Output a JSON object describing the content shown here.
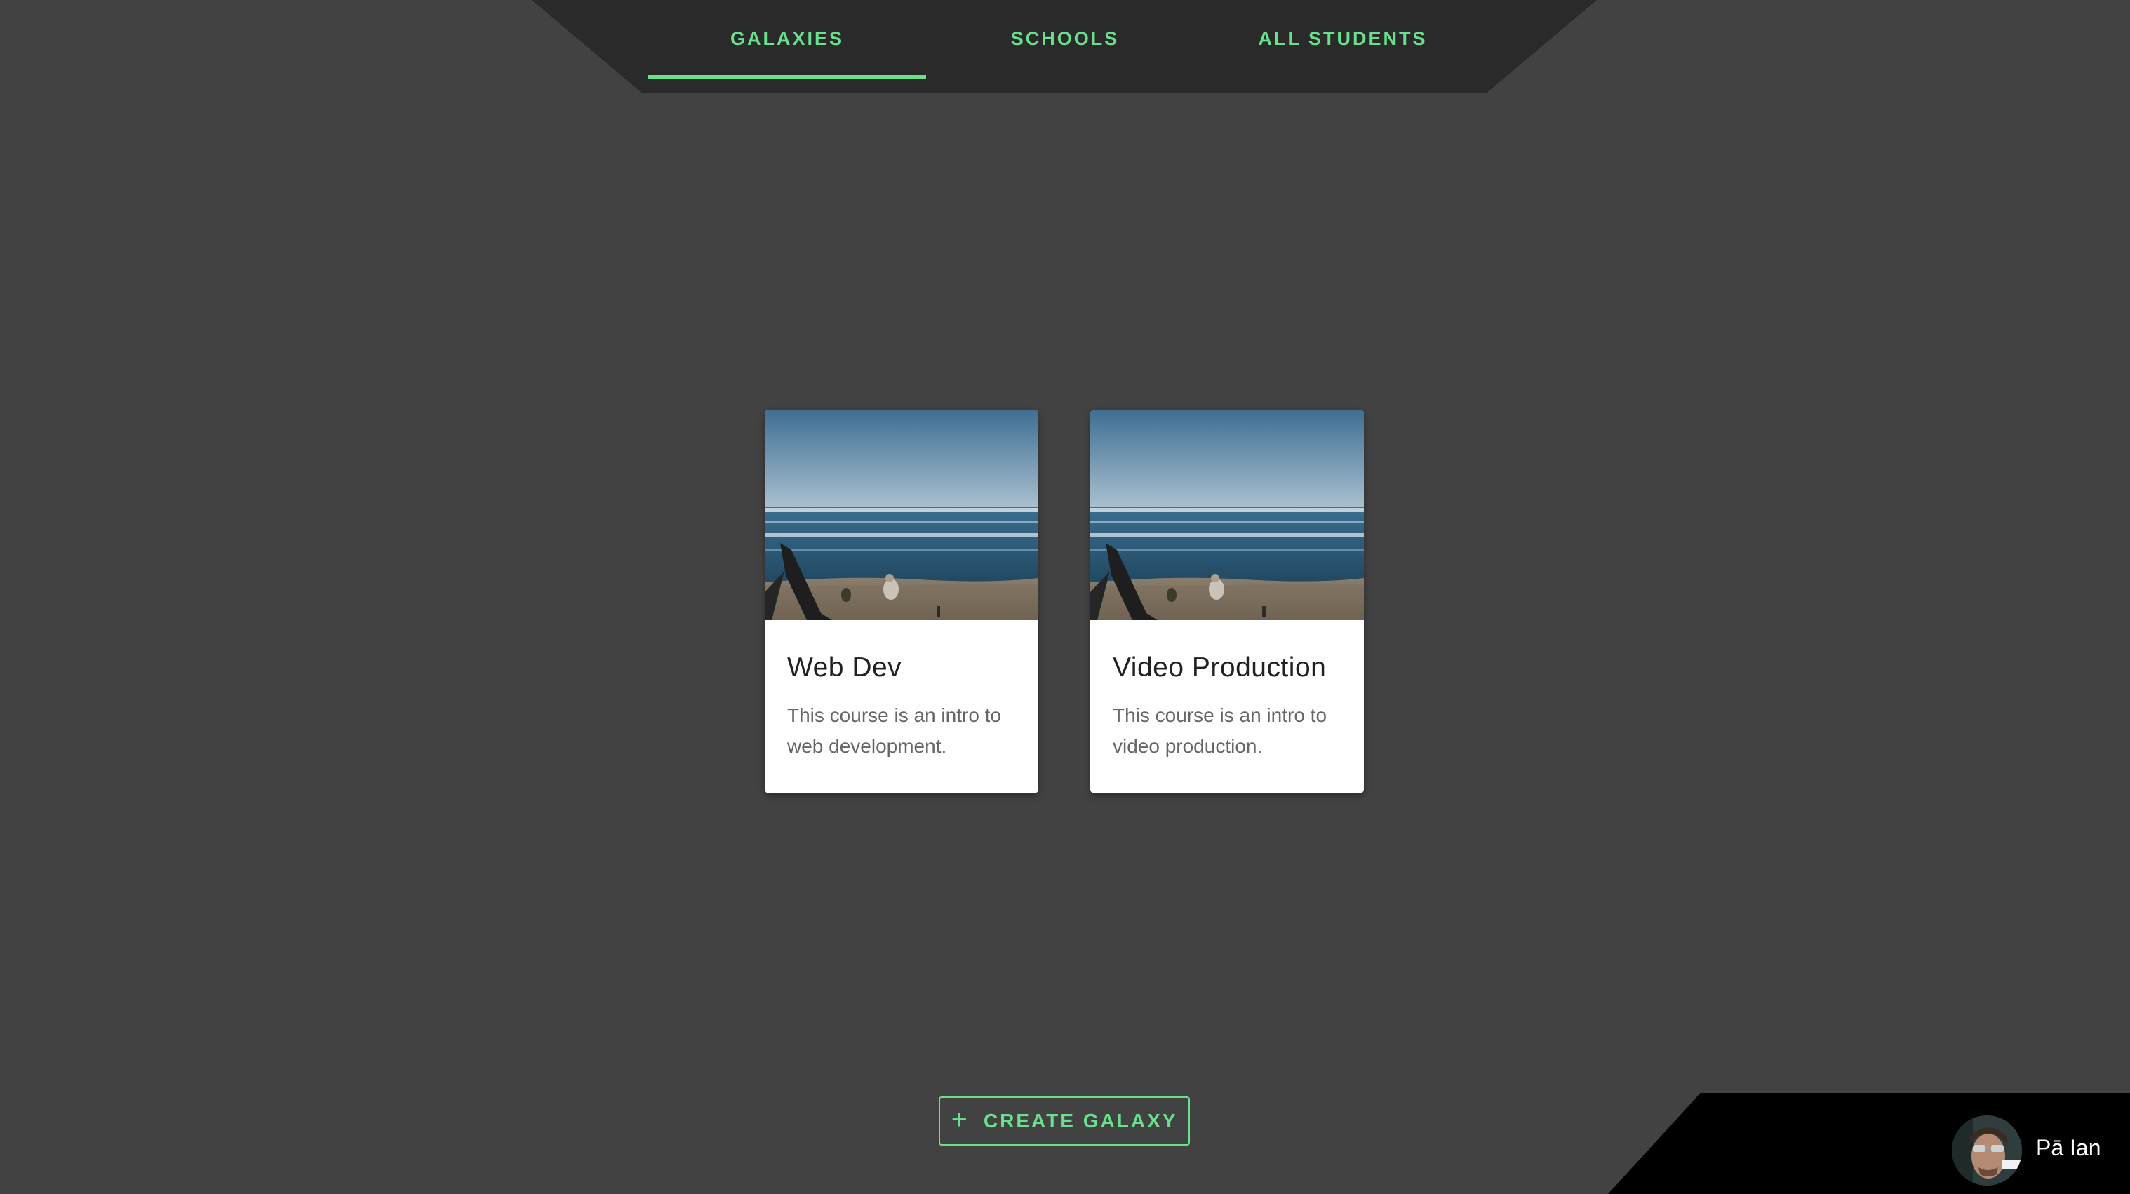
{
  "nav": {
    "tabs": [
      {
        "label": "GALAXIES",
        "active": true
      },
      {
        "label": "SCHOOLS",
        "active": false
      },
      {
        "label": "ALL STUDENTS",
        "active": false
      }
    ]
  },
  "cards": [
    {
      "title": "Web Dev",
      "description": "This course is an intro to web development."
    },
    {
      "title": "Video Production",
      "description": "This course is an intro to video production."
    }
  ],
  "create_button": {
    "icon": "plus-icon",
    "label": "CREATE GALAXY"
  },
  "user": {
    "name": "Pā Ian"
  },
  "colors": {
    "background": "#424242",
    "nav_background": "#2a2a2a",
    "accent": "#69e08b",
    "card_background": "#ffffff",
    "user_corner": "#000000"
  }
}
